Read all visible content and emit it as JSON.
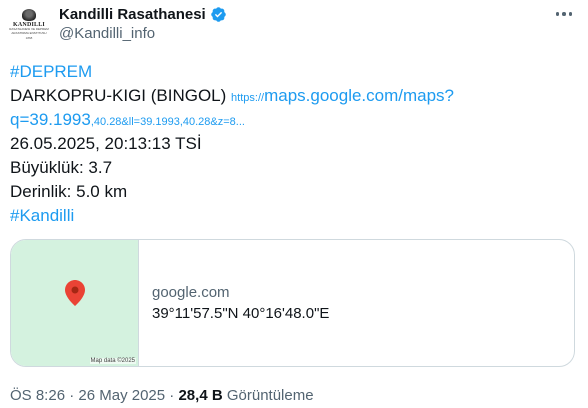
{
  "avatar": {
    "main": "KANDILLI",
    "sub": "RASATHANESI VE DEPREM ARASTIRMA ENSTITUSU",
    "year": "1868"
  },
  "user": {
    "display_name": "Kandilli Rasathanesi",
    "handle": "@Kandilli_info",
    "verified": true
  },
  "tweet": {
    "hashtag1": "#DEPREM",
    "location": "DARKOPRU-KIGI (BINGOL)",
    "link_prefix": "https://",
    "link_main": "maps.google.com/maps?",
    "link_line2_big": "q=39.1993",
    "link_line2_small": ",40.28&ll=39.1993,40.28&z=8...",
    "datetime": "26.05.2025, 20:13:13 TSİ",
    "magnitude": "Büyüklük: 3.7",
    "depth": "Derinlik: 5.0 km",
    "hashtag2": "#Kandilli"
  },
  "card": {
    "domain": "google.com",
    "title": "39°11'57.5\"N 40°16'48.0\"E",
    "map_attribution": "Map data ©2025"
  },
  "meta": {
    "time": "ÖS 8:26",
    "separator": "·",
    "date": "26 May 2025",
    "views_count": "28,4 B",
    "views_label": "Görüntüleme"
  },
  "colors": {
    "link": "#1d9bf0",
    "secondary_text": "#536471",
    "map_bg": "#d4f2df",
    "pin": "#ea4335"
  }
}
